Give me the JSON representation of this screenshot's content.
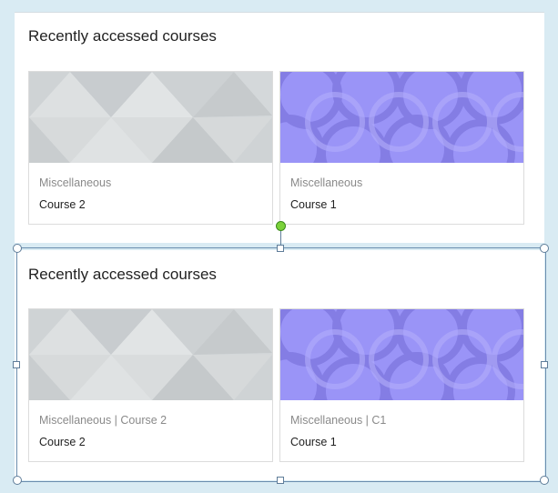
{
  "top_section": {
    "title": "Recently accessed courses",
    "cards": [
      {
        "category": "Miscellaneous",
        "name": "Course 2",
        "pattern": "grey-triangles"
      },
      {
        "category": "Miscellaneous",
        "name": "Course 1",
        "pattern": "purple-circles"
      }
    ]
  },
  "bottom_section": {
    "title": "Recently accessed courses",
    "cards": [
      {
        "category": "Miscellaneous | Course 2",
        "name": "Course 2",
        "pattern": "grey-triangles"
      },
      {
        "category": "Miscellaneous | C1",
        "name": "Course 1",
        "pattern": "purple-circles"
      }
    ]
  },
  "colors": {
    "background": "#d9ebf3",
    "grey_pattern": "#d4d8da",
    "purple_pattern": "#9a94f7",
    "rotation_handle": "#7bd23a"
  }
}
